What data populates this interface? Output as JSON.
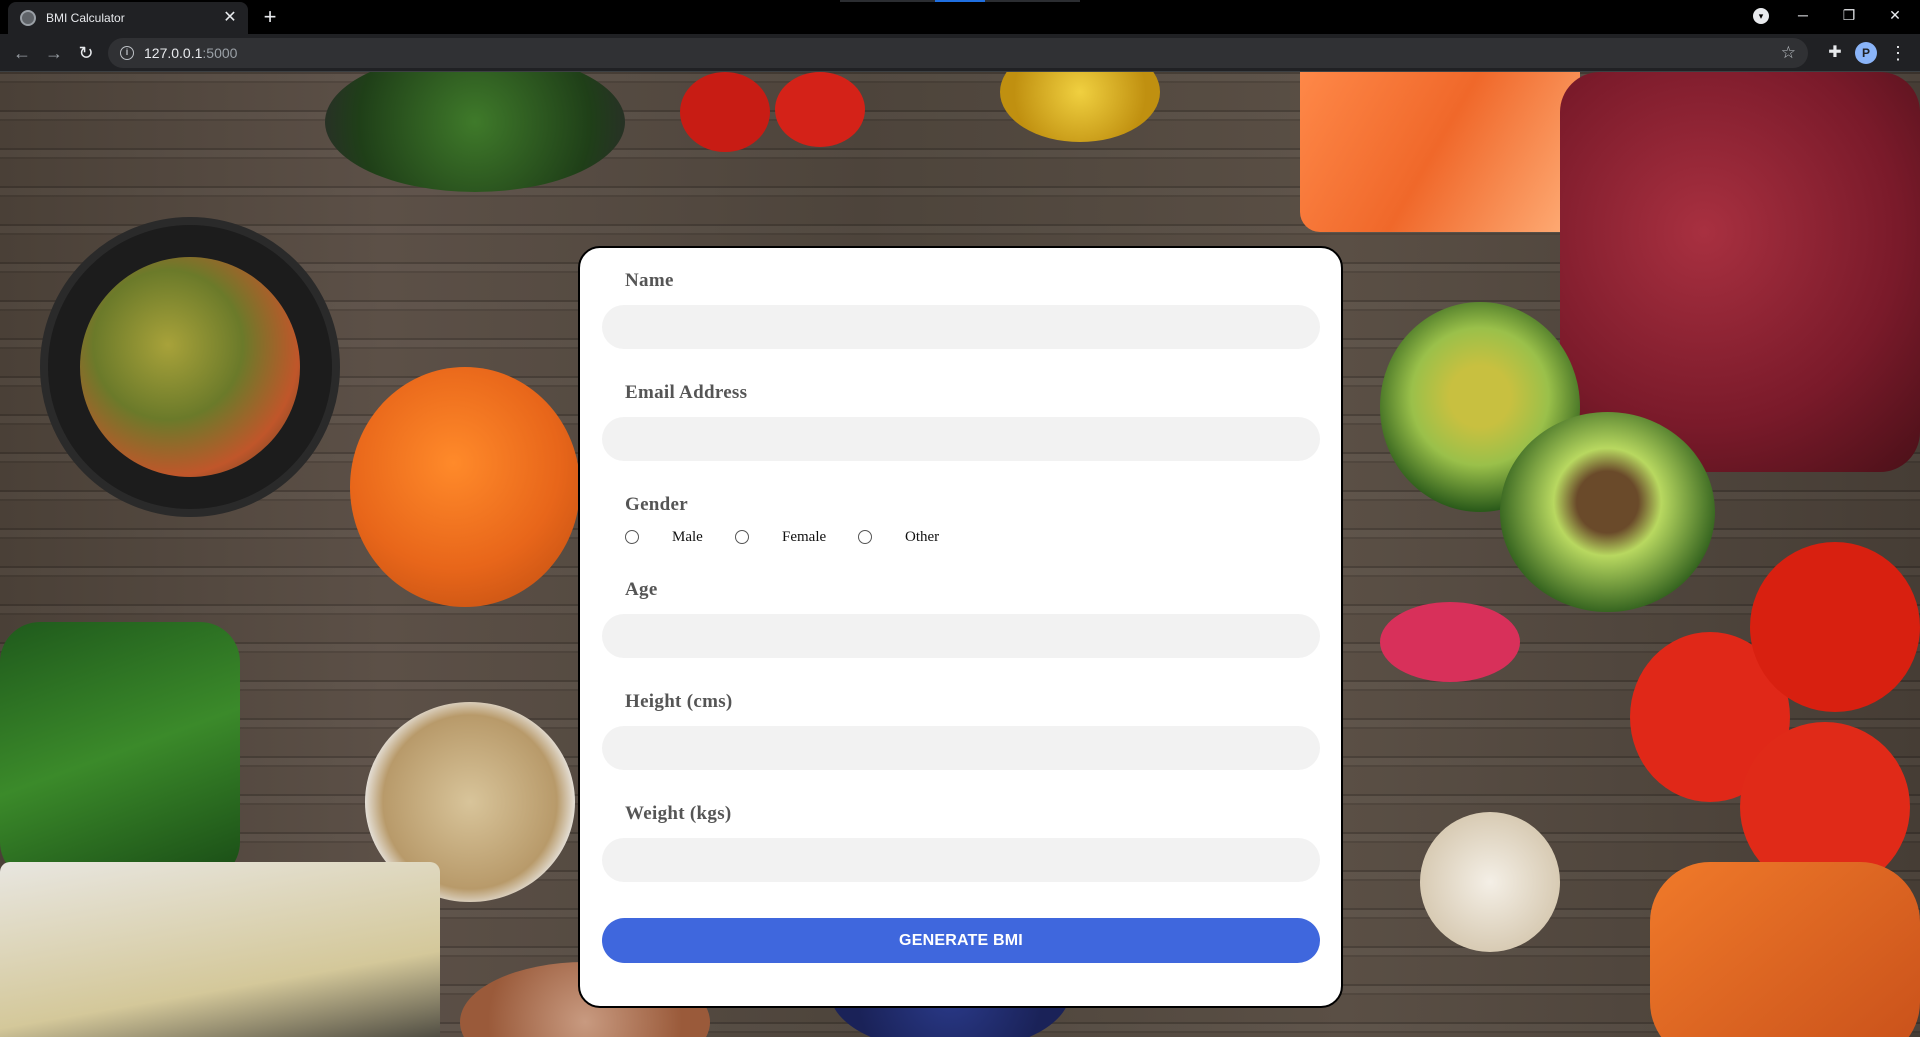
{
  "browser": {
    "tab_title": "BMI Calculator",
    "tab_close_glyph": "✕",
    "new_tab_glyph": "+",
    "url_host": "127.0.0.1",
    "url_port": ":5000",
    "profile_initial": "P",
    "icons": [
      "back-arrow-icon",
      "forward-arrow-icon",
      "reload-icon",
      "info-icon",
      "star-icon",
      "extensions-icon",
      "kebab-menu-icon"
    ]
  },
  "form": {
    "name_label": "Name",
    "email_label": "Email Address",
    "gender_label": "Gender",
    "gender_options": [
      "Male",
      "Female",
      "Other"
    ],
    "age_label": "Age",
    "height_label": "Height (cms)",
    "weight_label": "Weight (kgs)",
    "submit_label": "GENERATE BMI"
  },
  "colors": {
    "submit_button": "#3f67dd",
    "input_background": "#f2f2f2",
    "card_border": "#000000"
  }
}
